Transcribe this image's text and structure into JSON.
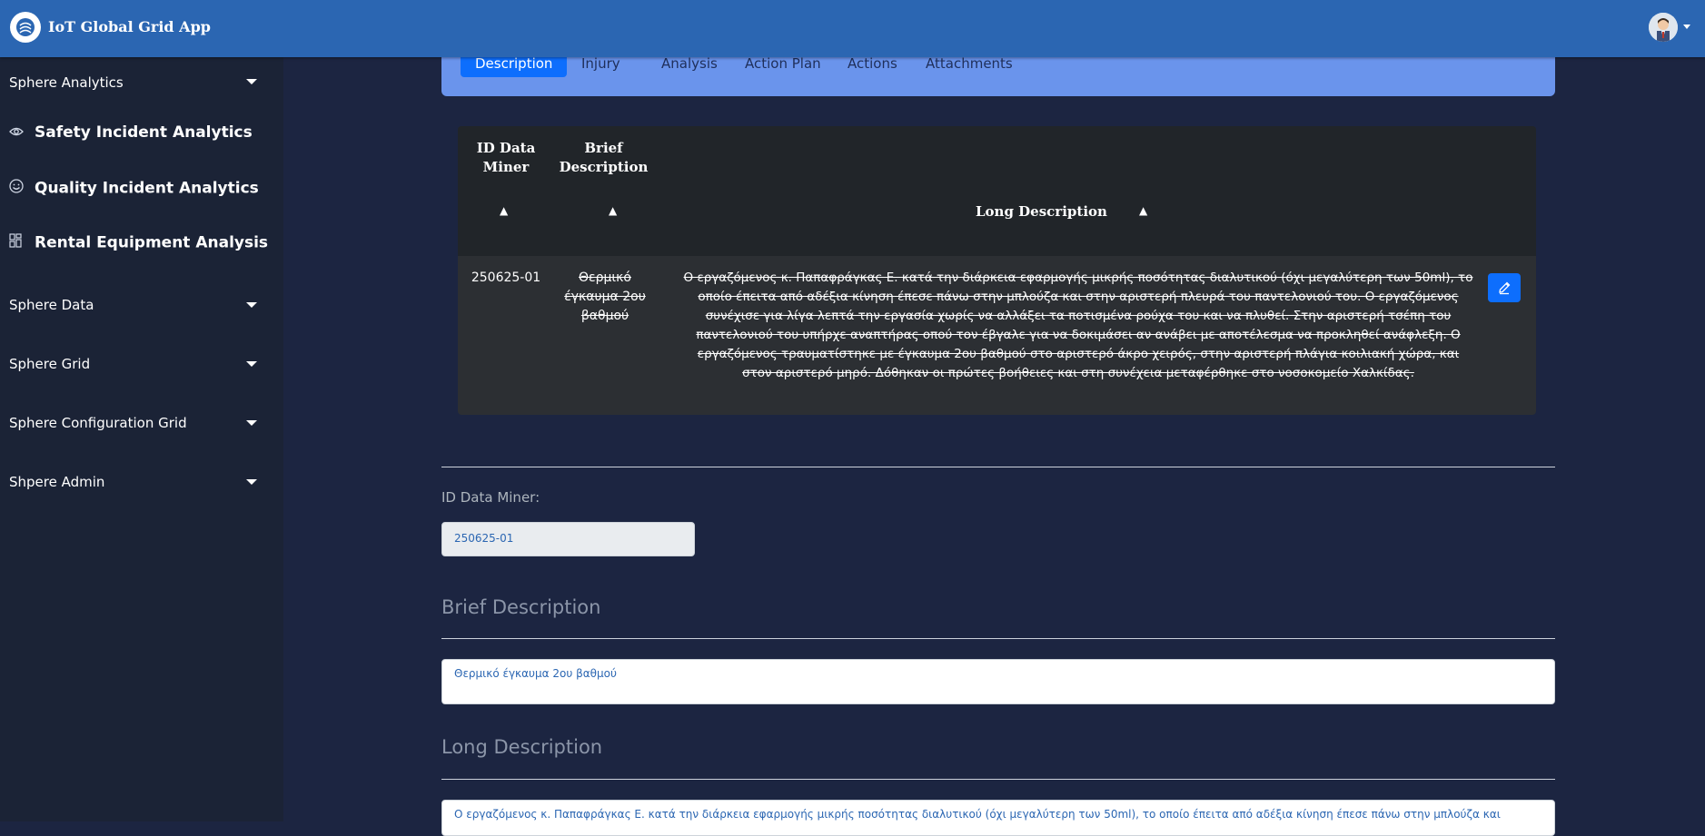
{
  "header": {
    "app_title": "IoT Global Grid App",
    "logo_icon": "logo-icon",
    "avatar_icon": "user-avatar"
  },
  "sidebar": {
    "groups": [
      {
        "label": "Sphere Analytics"
      },
      {
        "label": "Sphere Data"
      },
      {
        "label": "Sphere Grid"
      },
      {
        "label": "Sphere Configuration Grid"
      },
      {
        "label": "Shpere Admin"
      }
    ],
    "items": [
      {
        "label": "Safety Incident Analytics",
        "icon": "eye-icon"
      },
      {
        "label": "Quality Incident Analytics",
        "icon": "smile-icon"
      },
      {
        "label": "Rental Equipment Analysis",
        "icon": "grid-icon"
      }
    ]
  },
  "tabs": [
    {
      "label": "Description",
      "active": true
    },
    {
      "label": "Injury"
    },
    {
      "label": "Analysis"
    },
    {
      "label": "Action Plan"
    },
    {
      "label": "Actions"
    },
    {
      "label": "Attachments"
    }
  ],
  "table": {
    "headers": {
      "id": "ID Data Miner",
      "brief": "Brief Description",
      "long": "Long Description",
      "sort_symbol": "▲"
    },
    "row": {
      "id": "250625-01",
      "brief": "Θερμικό έγκαυμα 2ου βαθμού",
      "long": "Ο εργαζόμενος κ. Παπαφράγκας Ε. κατά την διάρκεια εφαρμογής μικρής ποσότητας διαλυτικού (όχι μεγαλύτερη των 50ml), το οποίο έπειτα από αδέξια κίνηση έπεσε πάνω στην μπλούζα και στην αριστερή πλευρά του παντελονιού του. Ο εργαζόμενος συνέχισε για λίγα λεπτά την εργασία χωρίς να αλλάξει τα ποτισμένα ρούχα του και να πλυθεί. Στην αριστερή τσέπη του παντελονιού του υπήρχε αναπτήρας οπού τον έβγαλε για να δοκιμάσει αν ανάβει με αποτέλεσμα να προκληθεί ανάφλεξη. Ο εργαζόμενος τραυματίστηκε με έγκαυμα 2ου βαθμού στο αριστερό άκρο χειρός, στην αριστερή πλάγια κοιλιακή χώρα, και στον αριστερό μηρό. Δόθηκαν οι πρώτες βοήθειες και στη συνέχεια μεταφέρθηκε στο νοσοκομείο Χαλκίδας."
    }
  },
  "form": {
    "id_label": "ID Data Miner:",
    "id_value": "250625-01",
    "brief_title": "Brief Description",
    "brief_value": "Θερμικό έγκαυμα 2ου βαθμού",
    "long_title": "Long Description",
    "long_value": "Ο εργαζόμενος κ. Παπαφράγκας Ε. κατά την διάρκεια εφαρμογής μικρής ποσότητας διαλυτικού (όχι μεγαλύτερη των 50ml), το οποίο έπειτα από αδέξια κίνηση έπεσε πάνω στην μπλούζα και"
  }
}
